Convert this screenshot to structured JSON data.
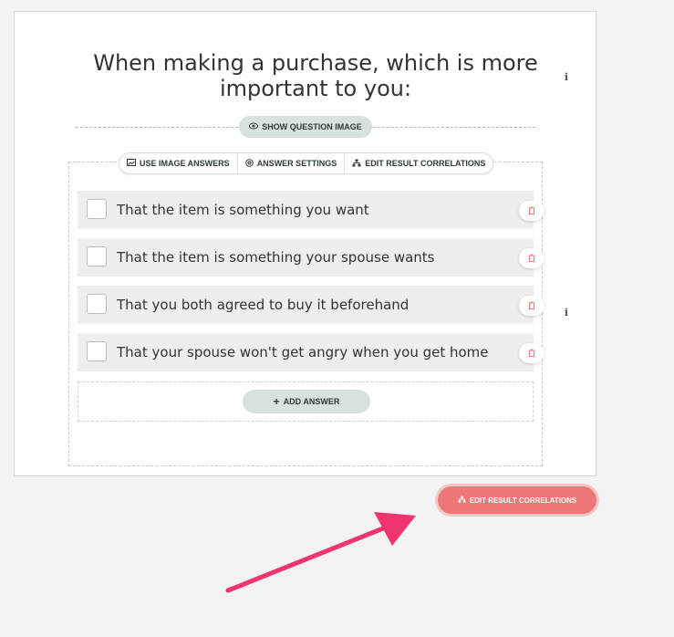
{
  "question": {
    "title": "When making a purchase, which is more important to you:",
    "show_image_label": "SHOW QUESTION IMAGE"
  },
  "toolbar": {
    "use_image_answers": "USE IMAGE ANSWERS",
    "answer_settings": "ANSWER SETTINGS",
    "edit_result_correlations": "EDIT RESULT CORRELATIONS"
  },
  "answers": [
    {
      "text": "That the item is something you want"
    },
    {
      "text": "That the item is something your spouse wants"
    },
    {
      "text": "That you both agreed to buy it beforehand"
    },
    {
      "text": "That your spouse won't get angry when you get home"
    }
  ],
  "add_answer_label": "ADD ANSWER",
  "edit_button_label": "EDIT RESULT CORRELATIONS",
  "colors": {
    "accent": "#ec7776",
    "pill": "#d7e2df",
    "annotation_arrow": "#f0346e"
  },
  "icons": {
    "info": "info-icon",
    "eye": "eye-icon",
    "image": "image-icon",
    "settings": "settings-icon",
    "hierarchy": "hierarchy-icon",
    "trash": "trash-icon",
    "plus": "plus-icon"
  }
}
